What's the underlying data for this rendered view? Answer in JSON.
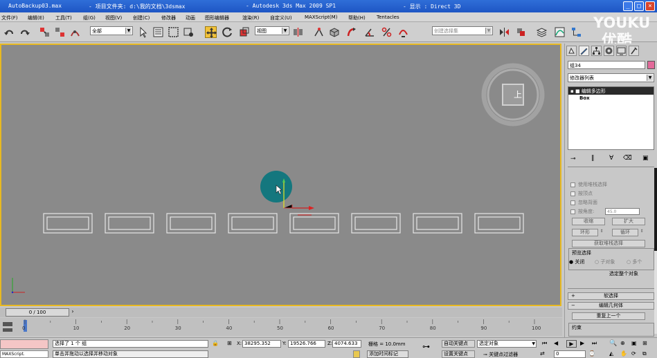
{
  "window": {
    "title_file": "AutoBackup03.max",
    "title_project": "- 项目文件夹: d:\\我的文档\\3dsmax",
    "title_app": "- Autodesk 3ds Max  2009 SP1",
    "title_display": "- 显示 : Direct 3D"
  },
  "menubar": {
    "items": [
      "文件(F)",
      "编辑(E)",
      "工具(T)",
      "组(G)",
      "视图(V)",
      "创建(C)",
      "修改器",
      "动画",
      "图形编辑器",
      "渲染(R)",
      "自定义(U)",
      "MAXScript(M)",
      "帮助(H)",
      "Tentacles"
    ]
  },
  "toolbar": {
    "selection_filter": "全部",
    "ref_coord": "视图",
    "named_selection": "创建选择集"
  },
  "viewport": {
    "label": "上",
    "accent_color": "#e8b920",
    "background_color": "#8a8a8a"
  },
  "command_panel": {
    "object_name": "组34",
    "modifier_list": "修改器列表",
    "stack_modifier": "编辑多边形",
    "stack_base": "Box",
    "checkboxes": [
      "使用堆栈选择",
      "按顶点",
      "忽略背面",
      "按角度:"
    ],
    "angle_value": "45.0",
    "btn_shrink": "收缩",
    "btn_grow": "扩大",
    "btn_ring": "环形",
    "btn_loop": "循环",
    "btn_get_stack": "获取堆栈选择",
    "preview_title": "预览选择",
    "radio_off": "关闭",
    "radio_subobj": "子对象",
    "radio_multi": "多个",
    "whole_object": "选定整个对象",
    "rollout_soft": "软选择",
    "rollout_edit_geo": "编辑几何体",
    "btn_repeat": "重复上一个",
    "constraints": "约束"
  },
  "timeline": {
    "slider_label": "0 / 100",
    "ticks": [
      "0",
      "10",
      "20",
      "30",
      "40",
      "50",
      "60",
      "70",
      "80",
      "90",
      "100"
    ]
  },
  "status": {
    "maxscript": "MAXScript.",
    "selection_msg": "选择了 1 个 组",
    "prompt_msg": "单击并拖动以选择并移动对象",
    "x_label": "X:",
    "x_value": "38295.352",
    "y_label": "Y:",
    "y_value": "19526.766",
    "z_label": "Z:",
    "z_value": "4074.633",
    "grid": "栅格 = 10.0mm",
    "add_time_tag": "添加时间标记",
    "auto_key": "自动关键点",
    "set_key": "设置关键点",
    "selected_obj": "选定对象",
    "key_filters": "关键点过滤器",
    "frame": "0"
  },
  "watermark": {
    "line1": "YOUKU",
    "line2": "优酷"
  }
}
